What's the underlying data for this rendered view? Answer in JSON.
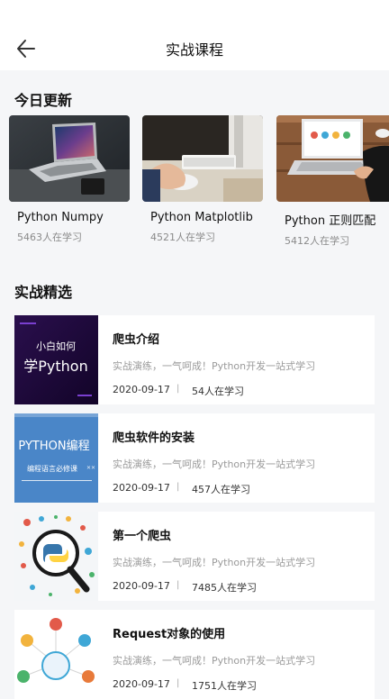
{
  "header": {
    "title": "实战课程",
    "back_icon": "arrow-left-icon"
  },
  "today": {
    "section_title": "今日更新",
    "items": [
      {
        "title": "Python Numpy",
        "sub": "5463人在学习"
      },
      {
        "title": "Python Matplotlib",
        "sub": "4521人在学习"
      },
      {
        "title": "Python 正则匹配",
        "sub": "5412人在学习"
      }
    ]
  },
  "featured": {
    "section_title": "实战精选",
    "items": [
      {
        "title": "爬虫介绍",
        "desc": "实战演练，一气呵成！Python开发一站式学习",
        "date": "2020-09-17",
        "separator": "|",
        "count": "54人在学习",
        "thumb_text_1": "小白如何",
        "thumb_text_2": "学Python"
      },
      {
        "title": "爬虫软件的安装",
        "desc": "实战演练，一气呵成！Python开发一站式学习",
        "date": "2020-09-17",
        "separator": "|",
        "count": "457人在学习",
        "thumb_text_1": "PYTHON编程",
        "thumb_text_2": "编程语言必修课"
      },
      {
        "title": "第一个爬虫",
        "desc": "实战演练，一气呵成！Python开发一站式学习",
        "date": "2020-09-17",
        "separator": "|",
        "count": "7485人在学习"
      },
      {
        "title": "Request对象的使用",
        "desc": "实战演练，一气呵成！Python开发一站式学习",
        "date": "2020-09-17",
        "separator": "|",
        "count": "1751人在学习"
      }
    ]
  }
}
